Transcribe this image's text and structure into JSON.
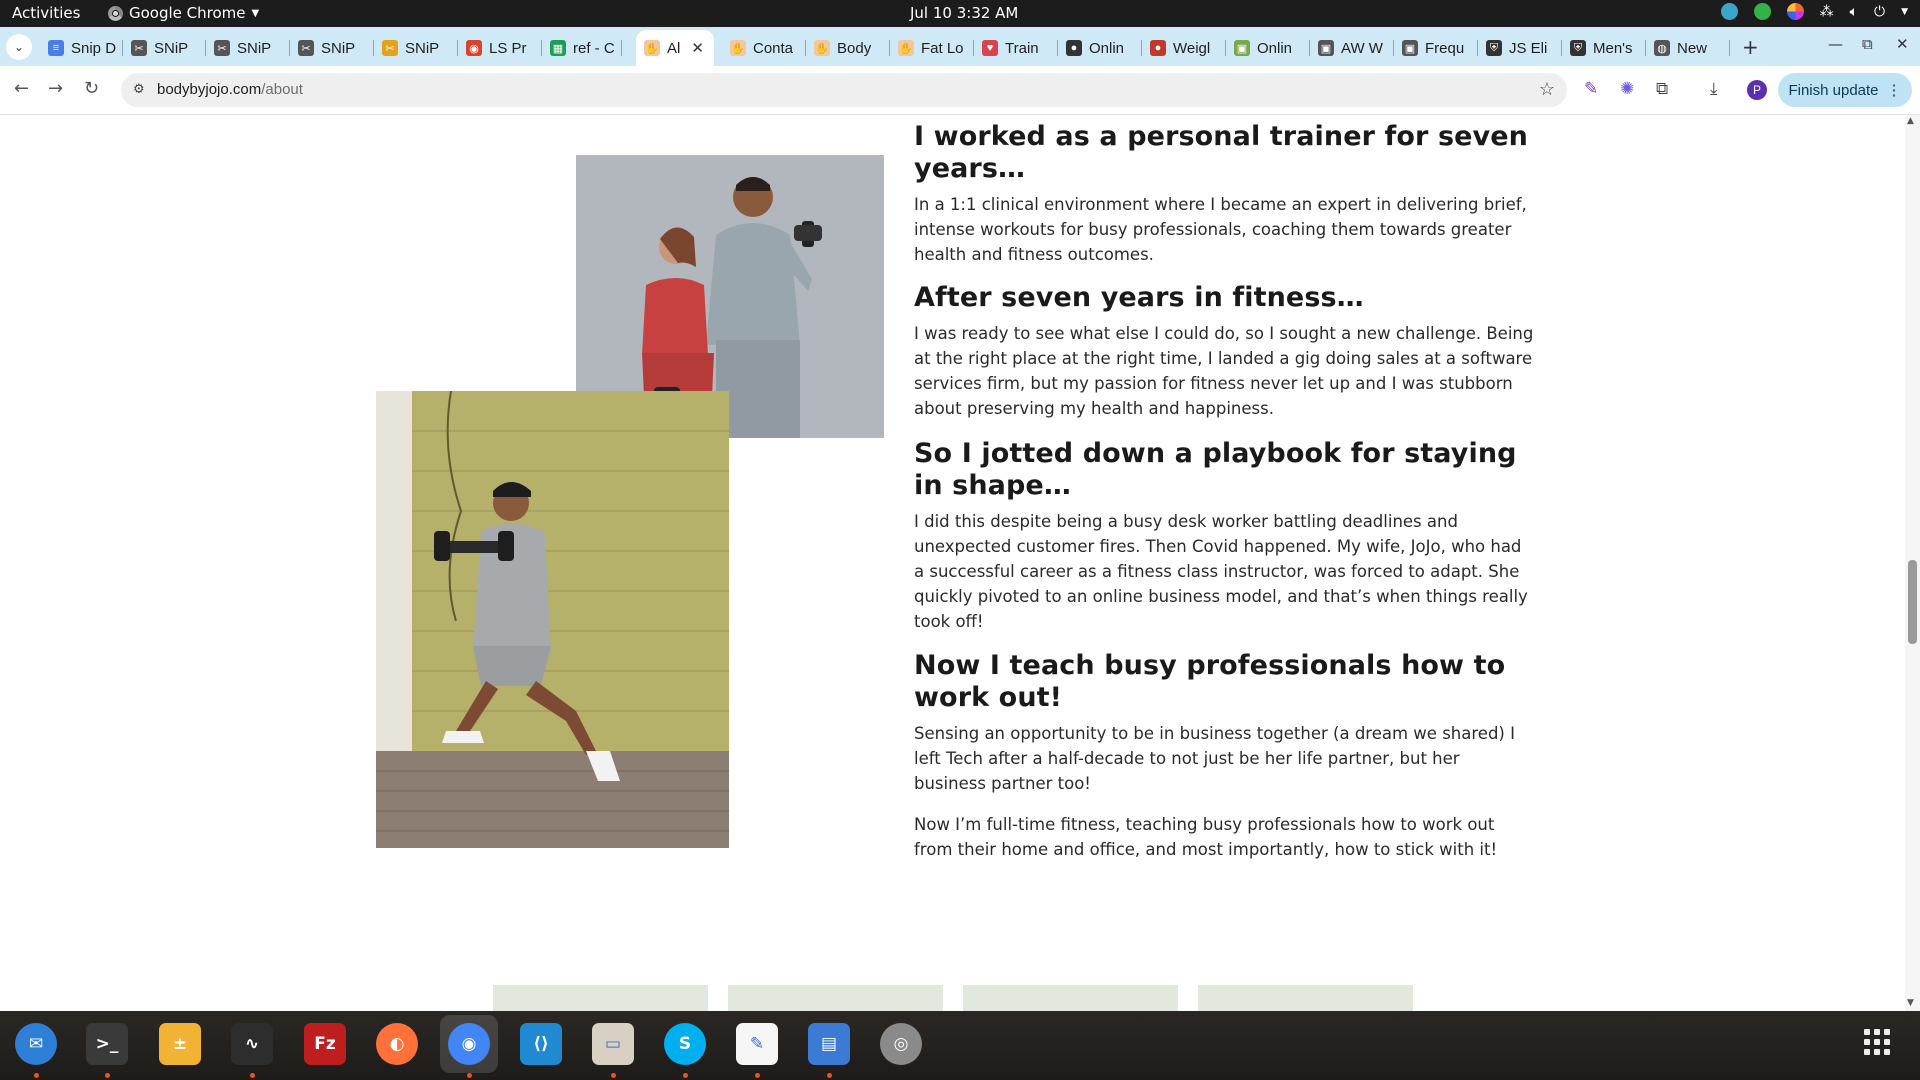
{
  "topbar": {
    "activities": "Activities",
    "app_name": "Google Chrome",
    "clock": "Jul 10  3:32 AM"
  },
  "tabs": [
    {
      "label": "Snip D",
      "icon": "doc-icon",
      "color": "#4a7ee6"
    },
    {
      "label": "SNiP",
      "icon": "snip-icon",
      "color": "#555555"
    },
    {
      "label": "SNiP",
      "icon": "snip-icon",
      "color": "#555555"
    },
    {
      "label": "SNiP",
      "icon": "snip-icon",
      "color": "#555555"
    },
    {
      "label": "SNiP",
      "icon": "snip-icon",
      "color": "#e4a11b"
    },
    {
      "label": "LS Pr",
      "icon": "ls-icon",
      "color": "#d9432b"
    },
    {
      "label": "ref - C",
      "icon": "sheets-icon",
      "color": "#1f9d55"
    },
    {
      "label": "Al",
      "icon": "hand-icon",
      "color": "#f2c79b",
      "active": true
    },
    {
      "label": "Conta",
      "icon": "hand-icon",
      "color": "#f2c79b"
    },
    {
      "label": "Body",
      "icon": "hand-icon",
      "color": "#f2c79b"
    },
    {
      "label": "Fat Lo",
      "icon": "hand-icon",
      "color": "#f2c79b"
    },
    {
      "label": "Train",
      "icon": "heart-icon",
      "color": "#d9434f"
    },
    {
      "label": "Onlin",
      "icon": "person-icon",
      "color": "#333333"
    },
    {
      "label": "Weigl",
      "icon": "person-icon",
      "color": "#c0392b"
    },
    {
      "label": "Onlin",
      "icon": "image-icon",
      "color": "#7aa84a"
    },
    {
      "label": "AW W",
      "icon": "image-icon",
      "color": "#555555"
    },
    {
      "label": "Frequ",
      "icon": "image-icon",
      "color": "#555555"
    },
    {
      "label": "JS Eli",
      "icon": "shield-icon",
      "color": "#333333"
    },
    {
      "label": "Men's",
      "icon": "shield-icon",
      "color": "#333333"
    },
    {
      "label": "New",
      "icon": "globe-icon",
      "color": "#555555"
    }
  ],
  "omnibox": {
    "domain": "bodybyjojo.com",
    "path": "/about"
  },
  "toolbar": {
    "finish_update": "Finish update",
    "profile_initial": "P"
  },
  "about": {
    "sections": [
      {
        "heading": "I worked as a personal trainer for seven years…",
        "paragraphs": [
          "In a 1:1 clinical environment where I became an expert in delivering brief, intense workouts for busy professionals, coaching them towards greater health and fitness outcomes."
        ]
      },
      {
        "heading": "After seven years in fitness…",
        "paragraphs": [
          "I was ready to see what else I could do, so I sought a new challenge. Being at the right place at the right time, I landed a gig doing sales at a software services firm, but my passion for fitness never let up and I was stubborn about preserving my health and happiness."
        ]
      },
      {
        "heading": "So I jotted down a playbook for staying in shape…",
        "paragraphs": [
          "I did this despite being a busy desk worker battling deadlines and unexpected customer fires. Then Covid happened. My wife, JoJo, who had a successful career as a fitness class instructor, was forced to adapt. She quickly pivoted to an online business model, and that’s when things really took off!"
        ]
      },
      {
        "heading": "Now I teach busy professionals how to work out!",
        "paragraphs": [
          "Sensing an opportunity to be in business together (a dream we shared) I left Tech after a half-decade to not just be her life partner, but her business partner too!",
          "Now I’m full-time fitness, teaching busy professionals how to work out from their home and office, and most importantly, how to stick with it!"
        ]
      }
    ]
  },
  "dock": [
    {
      "name": "thunderbird-icon",
      "color": "#2f7fd6"
    },
    {
      "name": "terminal-icon",
      "color": "#3a3a3a"
    },
    {
      "name": "calculator-icon",
      "color": "#f2b233"
    },
    {
      "name": "system-monitor-icon",
      "color": "#2d2d2d"
    },
    {
      "name": "filezilla-icon",
      "color": "#bf1e1e"
    },
    {
      "name": "firefox-icon",
      "color": "#ff7139"
    },
    {
      "name": "chrome-icon",
      "color": "#4285f4"
    },
    {
      "name": "vscode-icon",
      "color": "#1f8ad2"
    },
    {
      "name": "files-icon",
      "color": "#d8d0c2"
    },
    {
      "name": "skype-icon",
      "color": "#00aff0"
    },
    {
      "name": "text-editor-icon",
      "color": "#f5f5f5"
    },
    {
      "name": "document-viewer-icon",
      "color": "#3b7bd4"
    },
    {
      "name": "disk-utility-icon",
      "color": "#8a8a8a"
    }
  ]
}
